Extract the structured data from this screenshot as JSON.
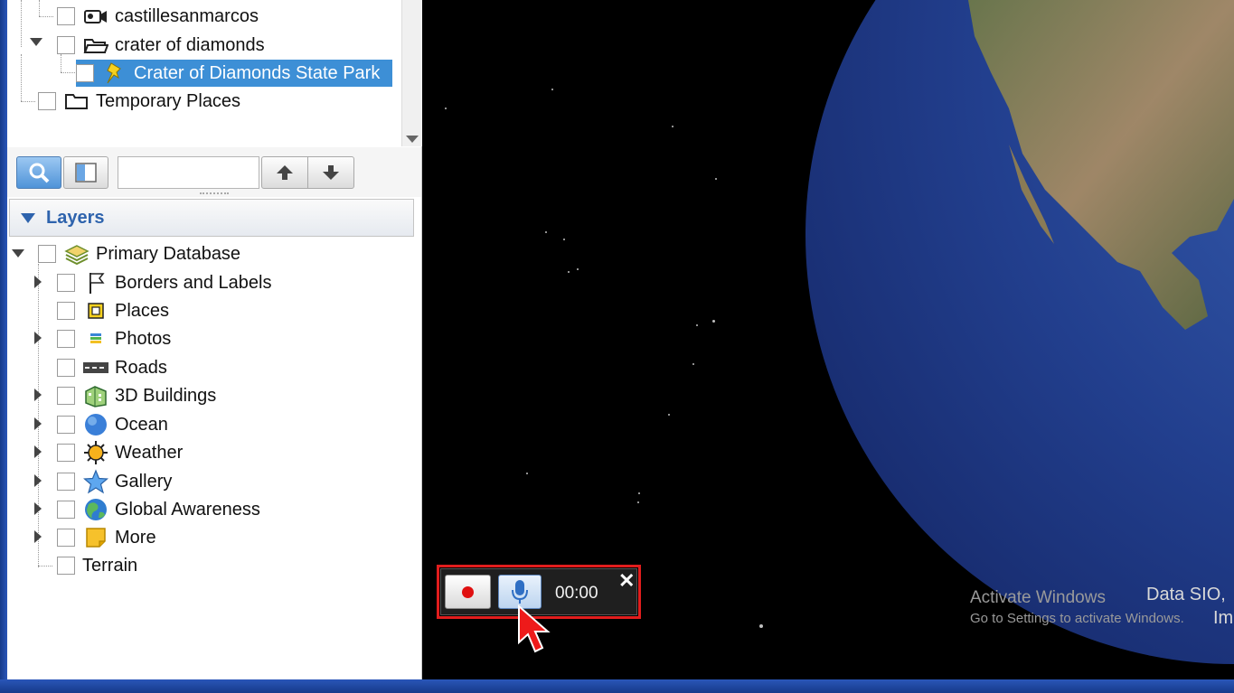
{
  "places_tree": {
    "items": [
      {
        "label": "castillesanmarcos",
        "icon": "tour-camera-icon",
        "checked": false
      },
      {
        "label": "crater of diamonds",
        "icon": "folder-open-icon",
        "checked": false,
        "expanded": true
      },
      {
        "label": "Crater of Diamonds State Park",
        "icon": "yellow-pushpin-icon",
        "checked": false,
        "selected": true
      },
      {
        "label": "Temporary Places",
        "icon": "folder-icon",
        "checked": false
      }
    ]
  },
  "search_toolbar": {
    "search_value": "",
    "buttons": [
      "search-icon",
      "sidebar-panel-icon",
      "arrow-up-icon",
      "arrow-down-icon"
    ]
  },
  "layers": {
    "header": "Layers",
    "root": {
      "label": "Primary Database",
      "icon": "database-layers-icon"
    },
    "items": [
      {
        "label": "Borders and Labels",
        "icon": "flag-icon",
        "expandable": true
      },
      {
        "label": "Places",
        "icon": "places-square-icon",
        "expandable": false
      },
      {
        "label": "Photos",
        "icon": "photos-icon",
        "expandable": true
      },
      {
        "label": "Roads",
        "icon": "road-icon",
        "expandable": false
      },
      {
        "label": "3D Buildings",
        "icon": "buildings-icon",
        "expandable": true
      },
      {
        "label": "Ocean",
        "icon": "ocean-globe-icon",
        "expandable": true
      },
      {
        "label": "Weather",
        "icon": "sun-icon",
        "expandable": true
      },
      {
        "label": "Gallery",
        "icon": "star-icon",
        "expandable": true
      },
      {
        "label": "Global Awareness",
        "icon": "globe-icon",
        "expandable": true
      },
      {
        "label": "More",
        "icon": "note-icon",
        "expandable": true
      }
    ],
    "terrain": "Terrain"
  },
  "tour_recorder": {
    "time": "00:00",
    "close": "✕"
  },
  "watermark": {
    "title": "Activate Windows",
    "subtitle": "Go to Settings to activate Windows."
  },
  "attribution": {
    "line1": "Data SIO,",
    "line2": "Im"
  },
  "colors": {
    "selection": "#3d8fd6",
    "layers_header_text": "#2e63ad",
    "recorder_highlight": "#e11d1d"
  }
}
